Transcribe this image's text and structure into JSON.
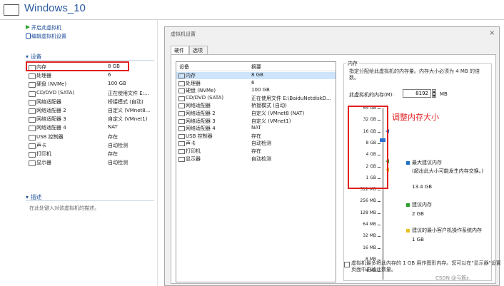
{
  "window": {
    "title": "Windows_10"
  },
  "actions": [
    {
      "label": "开启此虚拟机",
      "icon": "play-icon"
    },
    {
      "label": "编辑虚拟机设置",
      "icon": "edit-icon"
    }
  ],
  "devices_section": {
    "title": "设备"
  },
  "devices": [
    {
      "name": "内存",
      "value": "8 GB",
      "icon": "memory-icon"
    },
    {
      "name": "处理器",
      "value": "6",
      "icon": "cpu-icon"
    },
    {
      "name": "硬盘 (NVMe)",
      "value": "100 GB",
      "icon": "disk-icon"
    },
    {
      "name": "CD/DVD (SATA)",
      "value": "正在使用文件 E:...",
      "icon": "cd-icon"
    },
    {
      "name": "网络适配器",
      "value": "桥接模式 (自动)",
      "icon": "network-icon"
    },
    {
      "name": "网络适配器 2",
      "value": "自定义 (VMnet8...",
      "icon": "network-icon"
    },
    {
      "name": "网络适配器 3",
      "value": "自定义 (VMnet1)",
      "icon": "network-icon"
    },
    {
      "name": "网络适配器 4",
      "value": "NAT",
      "icon": "network-icon"
    },
    {
      "name": "USB 控制器",
      "value": "存在",
      "icon": "usb-icon"
    },
    {
      "name": "声卡",
      "value": "自动检测",
      "icon": "sound-icon"
    },
    {
      "name": "打印机",
      "value": "存在",
      "icon": "printer-icon"
    },
    {
      "name": "显示器",
      "value": "自动检测",
      "icon": "display-icon"
    }
  ],
  "description_section": {
    "title": "描述",
    "placeholder": "在此处键入对该虚拟机的描述。"
  },
  "dialog": {
    "title": "虚拟机设置",
    "close": "×",
    "tabs": [
      "硬件",
      "选项"
    ],
    "list_headers": {
      "device": "设备",
      "summary": "摘要"
    },
    "list": [
      {
        "name": "内存",
        "value": "8 GB"
      },
      {
        "name": "处理器",
        "value": "6"
      },
      {
        "name": "硬盘 (NVMe)",
        "value": "100 GB"
      },
      {
        "name": "CD/DVD (SATA)",
        "value": "正在使用文件 E:\\BaiduNetdiskD..."
      },
      {
        "name": "网络适配器",
        "value": "桥接模式 (自动)"
      },
      {
        "name": "网络适配器 2",
        "value": "自定义 (VMnet8 (NAT)"
      },
      {
        "name": "网络适配器 3",
        "value": "自定义 (VMnet1)"
      },
      {
        "name": "网络适配器 4",
        "value": "NAT"
      },
      {
        "name": "USB 控制器",
        "value": "存在"
      },
      {
        "name": "声卡",
        "value": "自动检测"
      },
      {
        "name": "打印机",
        "value": "存在"
      },
      {
        "name": "显示器",
        "value": "自动检测"
      }
    ],
    "memory": {
      "legend": "内存",
      "description": "指定分配给此虚拟机的内存量。内存大小必须为 4 MB 的倍数。",
      "field_label": "此虚拟机的内存(M):",
      "field_value": "8192",
      "unit": "MB",
      "scale_labels": [
        "64 GB",
        "32 GB",
        "16 GB",
        "8 GB",
        "4 GB",
        "2 GB",
        "1 GB",
        "512 MB",
        "256 MB",
        "128 MB",
        "64 MB",
        "32 MB",
        "16 MB",
        "8 MB",
        "4 MB"
      ],
      "legend_items": [
        {
          "title": "最大建议内存",
          "detail": "(超出此大小可能发生内存交换。)",
          "value": "13.4 GB",
          "color": "#1e6fc8"
        },
        {
          "title": "建议内存",
          "value": "2 GB",
          "color": "#2aa02a"
        },
        {
          "title": "建议的最小客户机操作系统内存",
          "value": "1 GB",
          "color": "#e8c020"
        }
      ],
      "note": "虚拟机最多将此内存的 1 GB 用作图形内存。您可以在\"显示器\"设置页面中更改此数量。"
    }
  },
  "annotation": {
    "text": "调整内存大小",
    "color": "#e02020"
  },
  "watermark": "CSDN @亏筋z."
}
